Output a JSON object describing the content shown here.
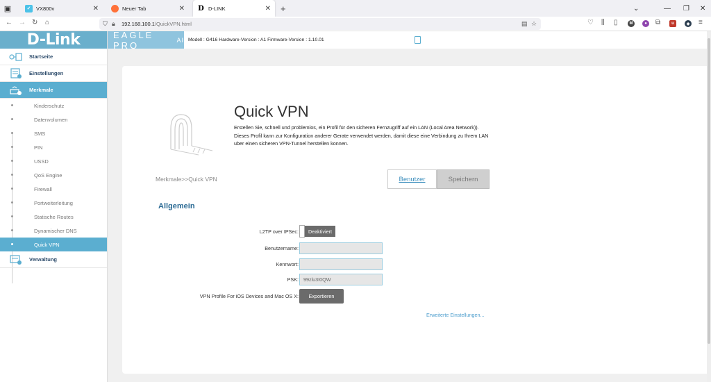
{
  "browser": {
    "tabs": [
      {
        "label": "VX800v",
        "favicon": "tp-link-icon"
      },
      {
        "label": "Neuer Tab",
        "favicon": "firefox-icon"
      },
      {
        "label": "D-LINK",
        "favicon": "dlink-d-icon"
      }
    ],
    "url_host": "192.168.100.1",
    "url_path": "/QuickVPN.html"
  },
  "header": {
    "logo": "D-Link",
    "eagle": "EAGLE PRO",
    "eagle_ai": "AI",
    "model_info": "Modell : G416 Hardware-Version : A1 Firmware-Version : 1.10.01"
  },
  "sidebar": {
    "startseite": "Startseite",
    "einstellungen": "Einstellungen",
    "merkmale": "Merkmale",
    "verwaltung": "Verwaltung",
    "sub_items": [
      "Kinderschutz",
      "Datenvolumen",
      "SMS",
      "PIN",
      "USSD",
      "QoS Engine",
      "Firewall",
      "Portweiterleitung",
      "Statische Routes",
      "Dynamischer DNS",
      "Quick VPN"
    ],
    "active_sub_index": 10
  },
  "main": {
    "title": "Quick VPN",
    "description": "Erstellen Sie, schnell und problemlos, ein Profil für den sicheren Fernzugriff auf ein LAN (Local Area Network)). Dieses Profil kann zur Konfiguration anderer Gerate verwendet werden, damit diese eine Verbindung zu Ihrem LAN uber einen sicheren VPN-Tunnel herstellen konnen.",
    "breadcrumb": "Merkmale>>Quick VPN",
    "user_button": "Benutzer",
    "save_button": "Speichern",
    "section_title": "Allgemein",
    "l2tp_label": "L2TP over IPSec:",
    "l2tp_state": "Deaktiviert",
    "username_label": "Benutzername:",
    "username_value": "",
    "password_label": "Kennwort:",
    "password_value": "",
    "psk_label": "PSK:",
    "psk_value": "99zlu3I0QW",
    "vpn_profile_label": "VPN Profile For iOS Devices and Mac OS X:",
    "export_button": "Exportieren",
    "advanced_link": "Erweiterte Einstellungen..."
  },
  "colors": {
    "accent": "#5baed0",
    "title_blue": "#2a6a94",
    "button_dark": "#6b6b6b"
  }
}
